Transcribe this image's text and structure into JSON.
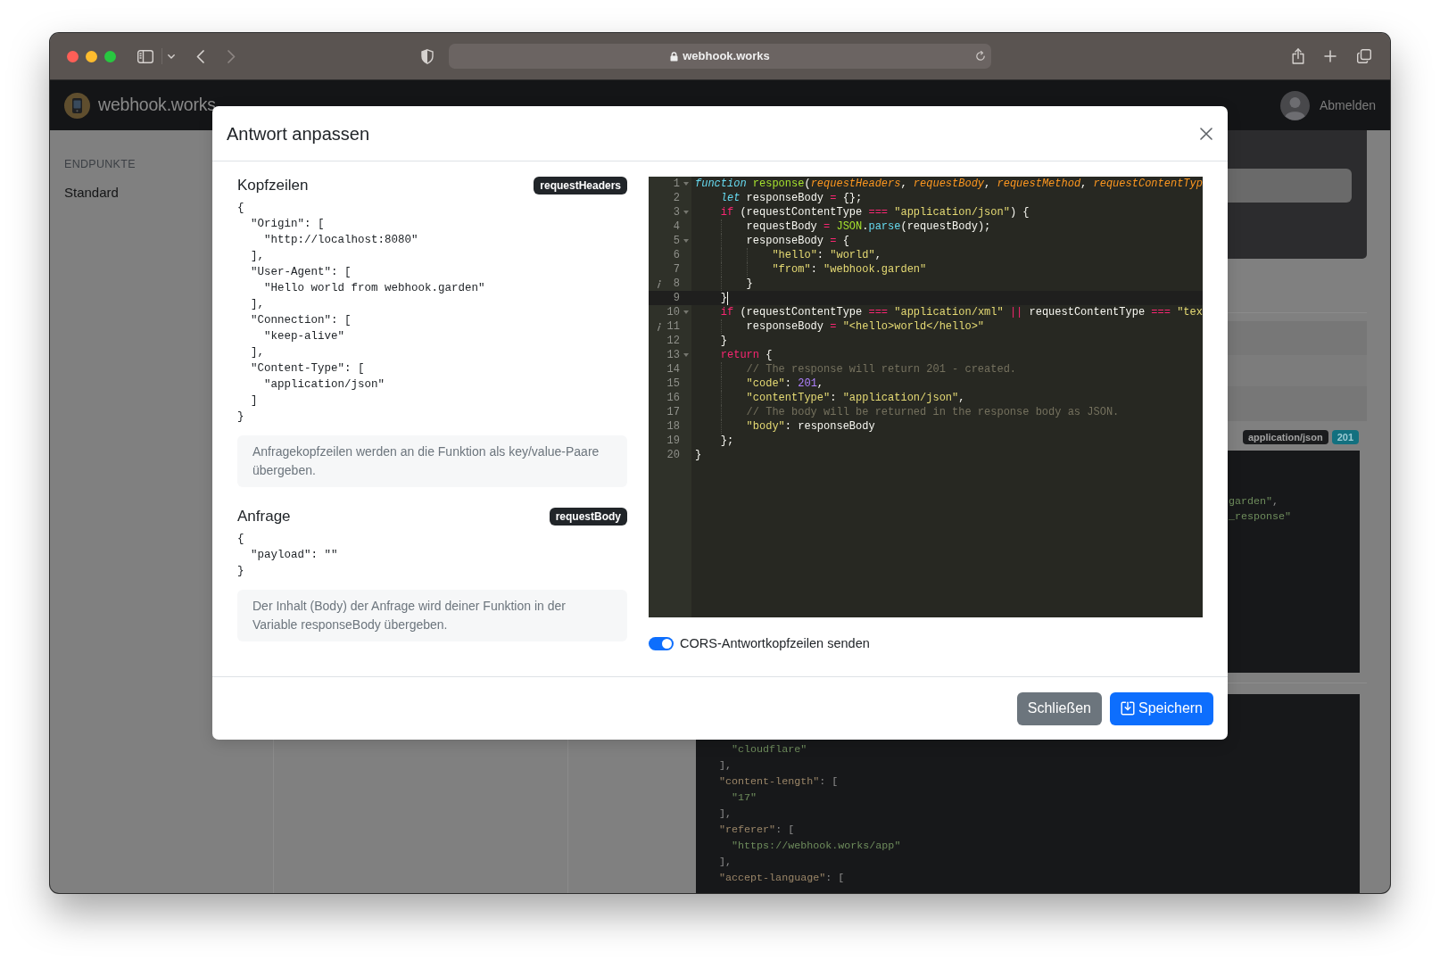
{
  "browser": {
    "url": "webhook.works"
  },
  "app_header": {
    "brand": "webhook.works",
    "logout": "Abmelden"
  },
  "sidebar": {
    "heading": "ENDPUNKTE",
    "items": [
      {
        "label": "Standard"
      }
    ]
  },
  "background_detail": {
    "badges": [
      {
        "kind": "content-type",
        "text": "application/json"
      },
      {
        "kind": "status",
        "text": "201"
      }
    ],
    "body_preview": [
      [
        {
          "kind": "string",
          "text": "garden\""
        },
        {
          "kind": "punct",
          "text": ","
        }
      ],
      [
        {
          "kind": "string",
          "text": "_response\""
        }
      ]
    ],
    "headers_preview": [
      [
        {
          "kind": "string",
          "text": "  \"cloudflare\""
        }
      ],
      [
        {
          "kind": "punct",
          "text": "],"
        }
      ],
      [
        {
          "kind": "key",
          "text": "\"content-length\""
        },
        {
          "kind": "punct",
          "text": ": ["
        }
      ],
      [
        {
          "kind": "string",
          "text": "  \"17\""
        }
      ],
      [
        {
          "kind": "punct",
          "text": "],"
        }
      ],
      [
        {
          "kind": "key",
          "text": "\"referer\""
        },
        {
          "kind": "punct",
          "text": ": ["
        }
      ],
      [
        {
          "kind": "string",
          "text": "  \"https://webhook.works/app\""
        }
      ],
      [
        {
          "kind": "punct",
          "text": "],"
        }
      ],
      [
        {
          "kind": "key",
          "text": "\"accept-language\""
        },
        {
          "kind": "punct",
          "text": ": ["
        }
      ]
    ]
  },
  "modal": {
    "title": "Antwort anpassen",
    "sections": [
      {
        "title": "Kopfzeilen",
        "variable": "requestHeaders",
        "code": [
          "{",
          "  \"Origin\": [",
          "    \"http://localhost:8080\"",
          "  ],",
          "  \"User-Agent\": [",
          "    \"Hello world from webhook.garden\"",
          "  ],",
          "  \"Connection\": [",
          "    \"keep-alive\"",
          "  ],",
          "  \"Content-Type\": [",
          "    \"application/json\"",
          "  ]",
          "}"
        ],
        "hint": "Anfragekopfzeilen werden an die Funktion als key/value-Paare übergeben."
      },
      {
        "title": "Anfrage",
        "variable": "requestBody",
        "code": [
          "{",
          "  \"payload\": \"\"",
          "}"
        ],
        "hint": "Der Inhalt (Body) der Anfrage wird deiner Funktion in der Variable responseBody übergeben."
      }
    ],
    "editor": {
      "lines": [
        {
          "number": "1",
          "fold": true,
          "annotation": false,
          "active": false,
          "tokens": [
            {
              "kind": "storage",
              "text": "function"
            },
            {
              "kind": "entity",
              "text": " response"
            },
            {
              "kind": "plain",
              "text": "("
            },
            {
              "kind": "param",
              "text": "requestHeaders"
            },
            {
              "kind": "plain",
              "text": ", "
            },
            {
              "kind": "param",
              "text": "requestBody"
            },
            {
              "kind": "plain",
              "text": ", "
            },
            {
              "kind": "param",
              "text": "requestMethod"
            },
            {
              "kind": "plain",
              "text": ", "
            },
            {
              "kind": "param",
              "text": "requestContentTyp"
            }
          ]
        },
        {
          "number": "2",
          "fold": false,
          "annotation": false,
          "active": false,
          "tokens": [
            {
              "kind": "storage",
              "text": "    let"
            },
            {
              "kind": "plain",
              "text": " responseBody "
            },
            {
              "kind": "keyword",
              "text": "="
            },
            {
              "kind": "plain",
              "text": " {};"
            }
          ]
        },
        {
          "number": "3",
          "fold": true,
          "annotation": false,
          "active": false,
          "tokens": [
            {
              "kind": "keyword",
              "text": "    if"
            },
            {
              "kind": "plain",
              "text": " (requestContentType "
            },
            {
              "kind": "keyword",
              "text": "==="
            },
            {
              "kind": "string",
              "text": " \"application/json\""
            },
            {
              "kind": "plain",
              "text": ") {"
            }
          ]
        },
        {
          "number": "4",
          "fold": false,
          "annotation": false,
          "active": false,
          "tokens": [
            {
              "kind": "plain",
              "text": "        requestBody "
            },
            {
              "kind": "keyword",
              "text": "="
            },
            {
              "kind": "support",
              "text": " JSON"
            },
            {
              "kind": "plain",
              "text": "."
            },
            {
              "kind": "func",
              "text": "parse"
            },
            {
              "kind": "plain",
              "text": "(requestBody);"
            }
          ]
        },
        {
          "number": "5",
          "fold": true,
          "annotation": false,
          "active": false,
          "tokens": [
            {
              "kind": "plain",
              "text": "        responseBody "
            },
            {
              "kind": "keyword",
              "text": "="
            },
            {
              "kind": "plain",
              "text": " {"
            }
          ]
        },
        {
          "number": "6",
          "fold": false,
          "annotation": false,
          "active": false,
          "tokens": [
            {
              "kind": "string",
              "text": "            \"hello\""
            },
            {
              "kind": "plain",
              "text": ": "
            },
            {
              "kind": "string",
              "text": "\"world\""
            },
            {
              "kind": "plain",
              "text": ","
            }
          ]
        },
        {
          "number": "7",
          "fold": false,
          "annotation": false,
          "active": false,
          "tokens": [
            {
              "kind": "string",
              "text": "            \"from\""
            },
            {
              "kind": "plain",
              "text": ": "
            },
            {
              "kind": "string",
              "text": "\"webhook.garden\""
            }
          ]
        },
        {
          "number": "8",
          "fold": false,
          "annotation": true,
          "active": false,
          "tokens": [
            {
              "kind": "plain",
              "text": "        }"
            }
          ]
        },
        {
          "number": "9",
          "fold": false,
          "annotation": false,
          "active": true,
          "tokens": [
            {
              "kind": "plain",
              "text": "    }"
            }
          ]
        },
        {
          "number": "10",
          "fold": true,
          "annotation": false,
          "active": false,
          "tokens": [
            {
              "kind": "keyword",
              "text": "    if"
            },
            {
              "kind": "plain",
              "text": " (requestContentType "
            },
            {
              "kind": "keyword",
              "text": "==="
            },
            {
              "kind": "string",
              "text": " \"application/xml\""
            },
            {
              "kind": "keyword",
              "text": " ||"
            },
            {
              "kind": "plain",
              "text": " requestContentType "
            },
            {
              "kind": "keyword",
              "text": "==="
            },
            {
              "kind": "string",
              "text": " \"tex"
            }
          ]
        },
        {
          "number": "11",
          "fold": false,
          "annotation": true,
          "active": false,
          "tokens": [
            {
              "kind": "plain",
              "text": "        responseBody "
            },
            {
              "kind": "keyword",
              "text": "="
            },
            {
              "kind": "string",
              "text": " \"<hello>world</hello>\""
            }
          ]
        },
        {
          "number": "12",
          "fold": false,
          "annotation": false,
          "active": false,
          "tokens": [
            {
              "kind": "plain",
              "text": "    }"
            }
          ]
        },
        {
          "number": "13",
          "fold": true,
          "annotation": false,
          "active": false,
          "tokens": [
            {
              "kind": "keyword",
              "text": "    return"
            },
            {
              "kind": "plain",
              "text": " {"
            }
          ]
        },
        {
          "number": "14",
          "fold": false,
          "annotation": false,
          "active": false,
          "tokens": [
            {
              "kind": "comment",
              "text": "        // The response will return 201 - created."
            }
          ]
        },
        {
          "number": "15",
          "fold": false,
          "annotation": false,
          "active": false,
          "tokens": [
            {
              "kind": "string",
              "text": "        \"code\""
            },
            {
              "kind": "plain",
              "text": ": "
            },
            {
              "kind": "number",
              "text": "201"
            },
            {
              "kind": "plain",
              "text": ","
            }
          ]
        },
        {
          "number": "16",
          "fold": false,
          "annotation": false,
          "active": false,
          "tokens": [
            {
              "kind": "string",
              "text": "        \"contentType\""
            },
            {
              "kind": "plain",
              "text": ": "
            },
            {
              "kind": "string",
              "text": "\"application/json\""
            },
            {
              "kind": "plain",
              "text": ","
            }
          ]
        },
        {
          "number": "17",
          "fold": false,
          "annotation": false,
          "active": false,
          "tokens": [
            {
              "kind": "comment",
              "text": "        // The body will be returned in the response body as JSON."
            }
          ]
        },
        {
          "number": "18",
          "fold": false,
          "annotation": false,
          "active": false,
          "tokens": [
            {
              "kind": "string",
              "text": "        \"body\""
            },
            {
              "kind": "plain",
              "text": ": responseBody"
            }
          ]
        },
        {
          "number": "19",
          "fold": false,
          "annotation": false,
          "active": false,
          "tokens": [
            {
              "kind": "plain",
              "text": "    };"
            }
          ]
        },
        {
          "number": "20",
          "fold": false,
          "annotation": false,
          "active": false,
          "tokens": [
            {
              "kind": "plain",
              "text": "}"
            }
          ]
        }
      ]
    },
    "cors": {
      "label": "CORS-Antwortkopfzeilen senden",
      "on": true
    },
    "buttons": [
      {
        "kind": "secondary",
        "label": "Schließen"
      },
      {
        "kind": "primary",
        "label": "Speichern"
      }
    ]
  }
}
